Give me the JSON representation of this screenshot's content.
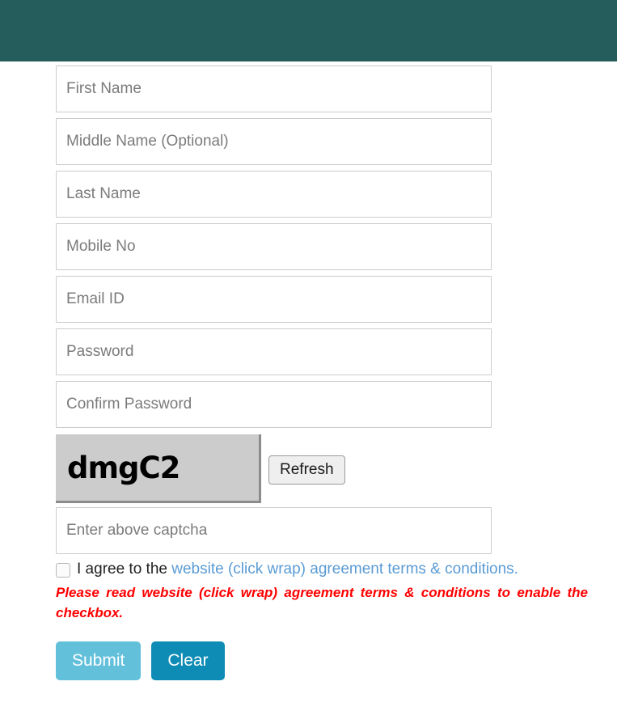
{
  "header": {
    "background_color": "#255c5c"
  },
  "form": {
    "fields": [
      {
        "name": "first-name",
        "placeholder": "First Name",
        "value": "",
        "type": "text"
      },
      {
        "name": "middle-name",
        "placeholder": "Middle Name (Optional)",
        "value": "",
        "type": "text"
      },
      {
        "name": "last-name",
        "placeholder": "Last Name",
        "value": "",
        "type": "text"
      },
      {
        "name": "mobile-no",
        "placeholder": "Mobile No",
        "value": "",
        "type": "text"
      },
      {
        "name": "email-id",
        "placeholder": "Email ID",
        "value": "",
        "type": "text"
      },
      {
        "name": "password",
        "placeholder": "Password",
        "value": "",
        "type": "password"
      },
      {
        "name": "confirm-password",
        "placeholder": "Confirm Password",
        "value": "",
        "type": "password"
      }
    ],
    "captcha": {
      "code": "dmgC2",
      "refresh_label": "Refresh",
      "input_placeholder": "Enter above captcha",
      "input_value": "",
      "background_color": "#cccccc"
    },
    "agreement": {
      "checked": false,
      "prefix_text": "I agree to the ",
      "link_text": "website (click wrap) agreement terms & conditions.",
      "link_color": "#5a9bd4",
      "warning_text": "Please read website (click wrap) agreement terms & conditions to enable the checkbox.",
      "warning_color": "#ff0000"
    },
    "actions": {
      "submit_label": "Submit",
      "submit_color": "#62c0db",
      "clear_label": "Clear",
      "clear_color": "#0e8cb5"
    }
  }
}
